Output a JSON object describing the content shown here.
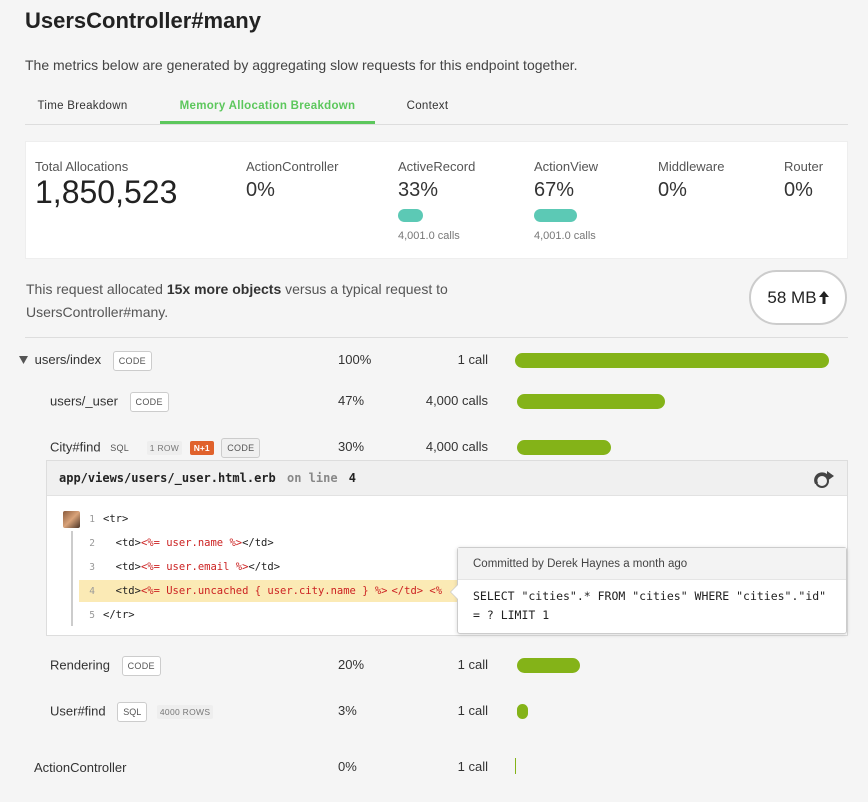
{
  "page": {
    "title": "UsersController#many",
    "subtitle": "The metrics below are generated by aggregating slow requests for this endpoint together."
  },
  "tabs": [
    {
      "label": "Time Breakdown",
      "active": false
    },
    {
      "label": "Memory Allocation Breakdown",
      "active": true
    },
    {
      "label": "Context",
      "active": false
    }
  ],
  "metrics": {
    "total": {
      "label": "Total Allocations",
      "value": "1,850,523"
    },
    "items": [
      {
        "label": "ActionController",
        "value": "0%"
      },
      {
        "label": "ActiveRecord",
        "value": "33%",
        "calls": "4,001.0 calls"
      },
      {
        "label": "ActionView",
        "value": "67%",
        "calls": "4,001.0 calls"
      },
      {
        "label": "Middleware",
        "value": "0%"
      },
      {
        "label": "Router",
        "value": "0%"
      }
    ]
  },
  "summary": {
    "prefix": "This request allocated ",
    "bold": "15x more objects",
    "suffix": " versus a typical request to UsersController#many.",
    "badge": "58 MB"
  },
  "rows": [
    {
      "name": "users/index",
      "tag": "CODE",
      "pct": "100%",
      "calls": "1 call",
      "fraction": 1.0
    },
    {
      "name": "users/_user",
      "tag": "CODE",
      "pct": "47%",
      "calls": "4,000 calls",
      "fraction": 0.47
    },
    {
      "name": "City#find",
      "sql": "SQL",
      "rows": "1 ROW",
      "badge": "N+1",
      "tag": "CODE",
      "pct": "30%",
      "calls": "4,000 calls",
      "fraction": 0.3
    },
    {
      "name": "Rendering",
      "tag": "CODE",
      "pct": "20%",
      "calls": "1 call",
      "fraction": 0.2
    },
    {
      "name": "User#find",
      "tag": "SQL",
      "rows": "4000 ROWS",
      "pct": "3%",
      "calls": "1 call",
      "fraction": 0.03
    },
    {
      "name": "ActionController",
      "pct": "0%",
      "calls": "1 call",
      "fraction": 0.0
    }
  ],
  "code": {
    "file": "app/views/users/_user.html.erb",
    "on_line": "on line",
    "line_no": "4",
    "lines": [
      {
        "n": "1",
        "pre": "<tr>",
        "erb": "",
        "post": ""
      },
      {
        "n": "2",
        "pre": "  <td>",
        "erb": "<%= user.name %>",
        "post": "</td>"
      },
      {
        "n": "3",
        "pre": "  <td>",
        "erb": "<%= user.email %>",
        "post": "</td>"
      },
      {
        "n": "4",
        "pre": "  <td>",
        "erb": "<%= User.uncached { user.city.name } %>",
        "post": "</td> <%",
        "highlight": true
      },
      {
        "n": "5",
        "pre": "</tr>",
        "erb": "",
        "post": ""
      }
    ]
  },
  "tooltip": {
    "header": "Committed by Derek Haynes a month ago",
    "body": "SELECT \"cities\".* FROM \"cities\" WHERE \"cities\".\"id\" = ? LIMIT 1"
  },
  "colors": {
    "accent": "#5cc75c",
    "bar": "#84b318",
    "pill": "#5cc9b5",
    "n1": "#e0622c"
  }
}
